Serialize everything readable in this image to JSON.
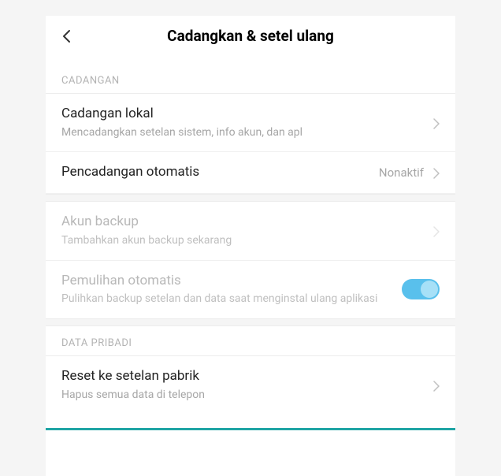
{
  "header": {
    "title": "Cadangkan & setel ulang"
  },
  "sections": {
    "cadangan": {
      "label": "CADANGAN",
      "local_backup": {
        "title": "Cadangan lokal",
        "subtitle": "Mencadangkan setelan sistem, info akun, dan apl"
      },
      "auto_backup": {
        "title": "Pencadangan otomatis",
        "value": "Nonaktif"
      },
      "backup_account": {
        "title": "Akun backup",
        "subtitle": "Tambahkan akun backup sekarang"
      },
      "auto_restore": {
        "title": "Pemulihan otomatis",
        "subtitle": "Pulihkan backup setelan dan data saat menginstal ulang aplikasi",
        "toggle_on": true
      }
    },
    "data_pribadi": {
      "label": "DATA PRIBADI",
      "factory_reset": {
        "title": "Reset ke setelan pabrik",
        "subtitle": "Hapus semua data di telepon"
      }
    }
  }
}
